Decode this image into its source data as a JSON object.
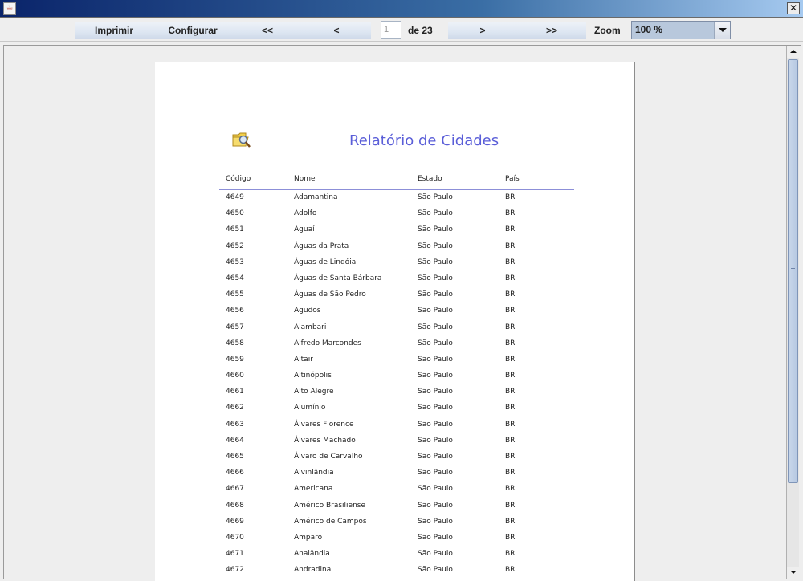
{
  "window": {
    "close_label": "✕"
  },
  "toolbar": {
    "print_label": "Imprimir",
    "configure_label": "Configurar",
    "first_label": "<<",
    "prev_label": "<",
    "page_current": "1",
    "page_of_label": "de 23",
    "next_label": ">",
    "last_label": ">>",
    "zoom_label": "Zoom",
    "zoom_value": "100 %"
  },
  "report": {
    "title": "Relatório de Cidades",
    "columns": [
      "Código",
      "Nome",
      "Estado",
      "País"
    ],
    "rows": [
      [
        "4649",
        "Adamantina",
        "São Paulo",
        "BR"
      ],
      [
        "4650",
        "Adolfo",
        "São Paulo",
        "BR"
      ],
      [
        "4651",
        "Aguaí",
        "São Paulo",
        "BR"
      ],
      [
        "4652",
        "Águas da Prata",
        "São Paulo",
        "BR"
      ],
      [
        "4653",
        "Águas de Lindóia",
        "São Paulo",
        "BR"
      ],
      [
        "4654",
        "Águas de Santa Bárbara",
        "São Paulo",
        "BR"
      ],
      [
        "4655",
        "Águas de São Pedro",
        "São Paulo",
        "BR"
      ],
      [
        "4656",
        "Agudos",
        "São Paulo",
        "BR"
      ],
      [
        "4657",
        "Alambari",
        "São Paulo",
        "BR"
      ],
      [
        "4658",
        "Alfredo Marcondes",
        "São Paulo",
        "BR"
      ],
      [
        "4659",
        "Altair",
        "São Paulo",
        "BR"
      ],
      [
        "4660",
        "Altinópolis",
        "São Paulo",
        "BR"
      ],
      [
        "4661",
        "Alto Alegre",
        "São Paulo",
        "BR"
      ],
      [
        "4662",
        "Alumínio",
        "São Paulo",
        "BR"
      ],
      [
        "4663",
        "Álvares Florence",
        "São Paulo",
        "BR"
      ],
      [
        "4664",
        "Álvares Machado",
        "São Paulo",
        "BR"
      ],
      [
        "4665",
        "Álvaro de Carvalho",
        "São Paulo",
        "BR"
      ],
      [
        "4666",
        "Alvinlândia",
        "São Paulo",
        "BR"
      ],
      [
        "4667",
        "Americana",
        "São Paulo",
        "BR"
      ],
      [
        "4668",
        "Américo Brasiliense",
        "São Paulo",
        "BR"
      ],
      [
        "4669",
        "Américo de Campos",
        "São Paulo",
        "BR"
      ],
      [
        "4670",
        "Amparo",
        "São Paulo",
        "BR"
      ],
      [
        "4671",
        "Analândia",
        "São Paulo",
        "BR"
      ],
      [
        "4672",
        "Andradina",
        "São Paulo",
        "BR"
      ]
    ]
  },
  "colors": {
    "title_text": "#5a5ed8",
    "header_line": "#8c8fd8",
    "titlebar_start": "#0a246a",
    "titlebar_end": "#a6caf0"
  },
  "icons": {
    "window": "java-icon",
    "close": "close-icon",
    "report": "folder-magnifier-icon",
    "zoom_dropdown": "chevron-down-icon"
  }
}
